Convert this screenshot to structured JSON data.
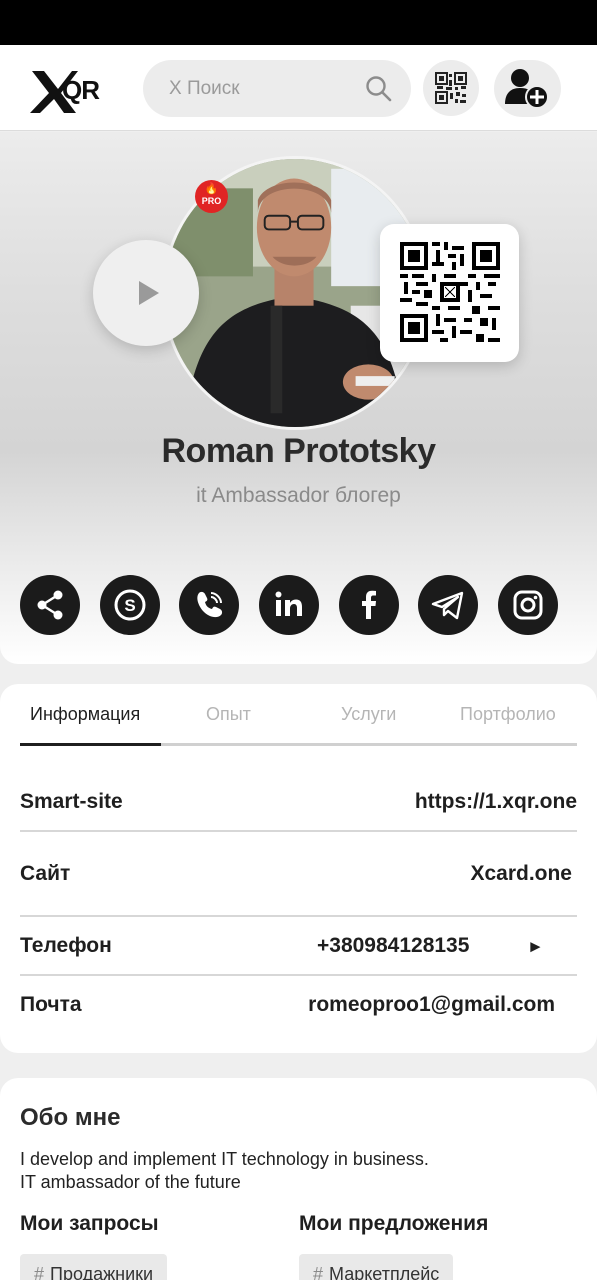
{
  "header": {
    "logo_text": "QR",
    "search_placeholder": "X Поиск",
    "icons": [
      "search-icon",
      "qr-code-icon",
      "add-user-icon"
    ]
  },
  "profile": {
    "name": "Roman Prototsky",
    "role": "it Ambassador блогер",
    "badge": "PRO",
    "socials": [
      "share",
      "skype",
      "viber",
      "linkedin",
      "facebook",
      "telegram",
      "instagram"
    ]
  },
  "tabs": [
    {
      "label": "Информация",
      "active": true
    },
    {
      "label": "Опыт",
      "active": false
    },
    {
      "label": "Услуги",
      "active": false
    },
    {
      "label": "Портфолио",
      "active": false
    }
  ],
  "info": [
    {
      "label": "Smart-site",
      "value": "https://1.xqr.one"
    },
    {
      "label": "Сайт",
      "value": "Xcard.one"
    },
    {
      "label": "Телефон",
      "value": "+380984128135",
      "action": "►"
    },
    {
      "label": "Почта",
      "value": "romeoproo1@gmail.com"
    }
  ],
  "about": {
    "title": "Обо мне",
    "text_line1": "I develop and implement IT technology in business.",
    "text_line2": "IT ambassador of the future",
    "requests_title": "Мои запросы",
    "offers_title": "Мои предложения",
    "request_tag": "Продажники",
    "offer_tag": "Маркетплейс",
    "tag_prefix": "#"
  },
  "colors": {
    "accent": "#1b1b1b",
    "badge": "#e02424",
    "muted": "#8a8a8a"
  }
}
